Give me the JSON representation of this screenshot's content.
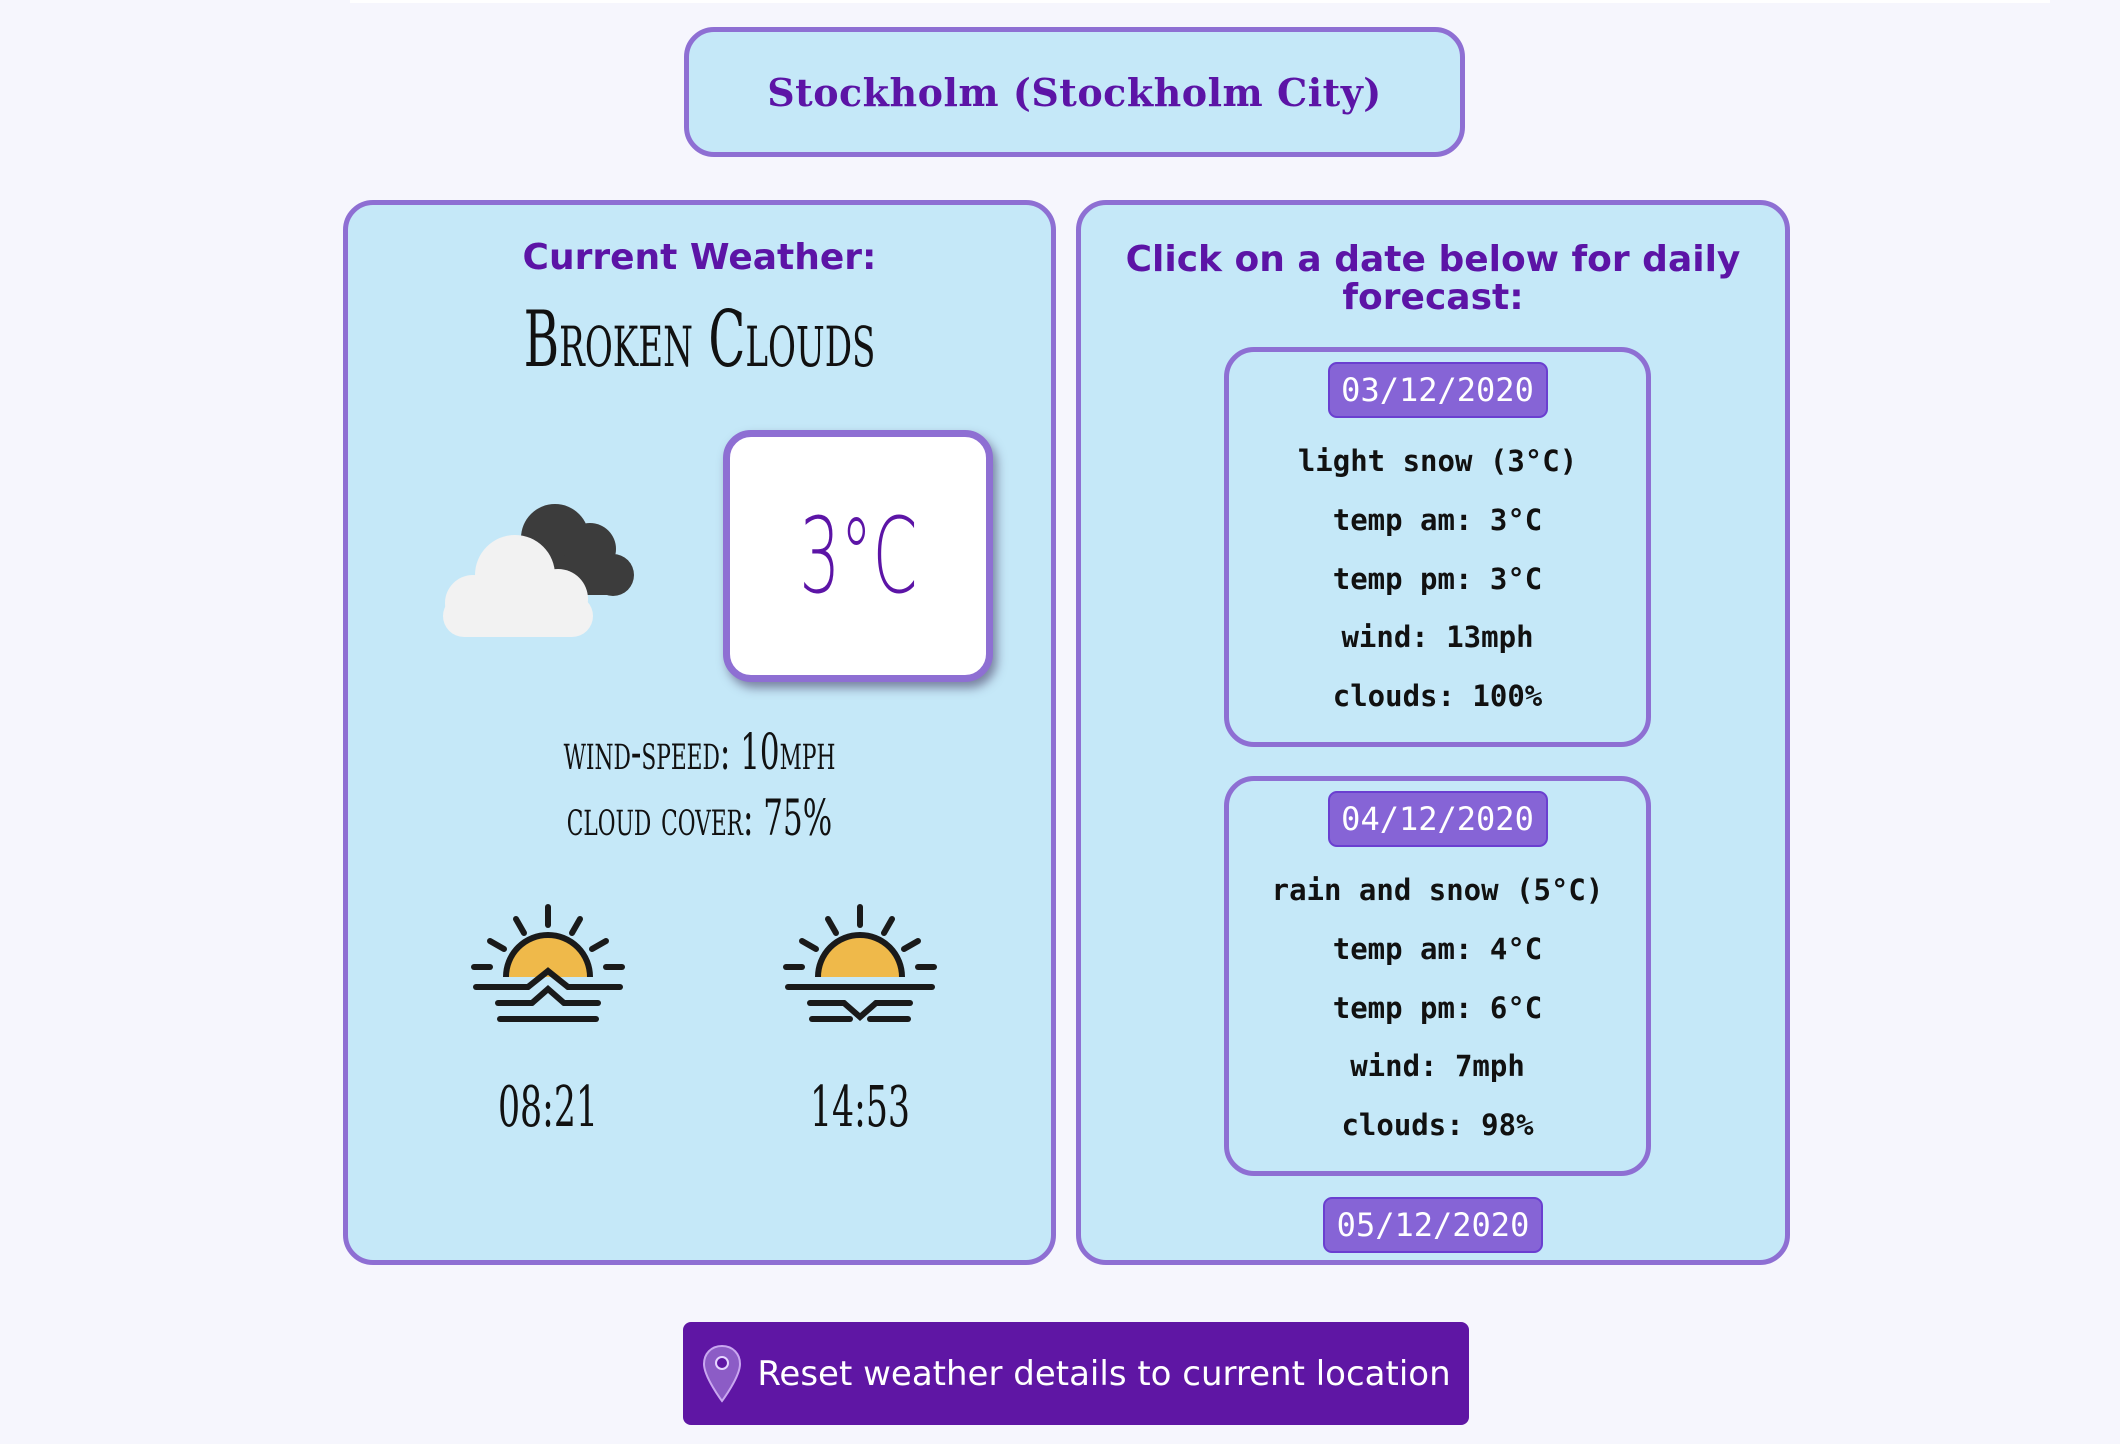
{
  "location": {
    "title": "Stockholm (Stockholm City)"
  },
  "current": {
    "heading": "Current Weather:",
    "description": "Broken Clouds",
    "icon": "broken-clouds-icon",
    "temperature": "3°C",
    "wind_speed": "wind-speed: 10mph",
    "cloud_cover": "cloud cover: 75%",
    "sunrise": {
      "icon": "sunrise-icon",
      "time": "08:21"
    },
    "sunset": {
      "icon": "sunset-icon",
      "time": "14:53"
    }
  },
  "forecast": {
    "heading": "Click on a date below for daily forecast:",
    "days": [
      {
        "date": "03/12/2020",
        "summary": "light snow (3°C)",
        "temp_am": "temp am: 3°C",
        "temp_pm": "temp pm: 3°C",
        "wind": "wind: 13mph",
        "clouds": "clouds: 100%"
      },
      {
        "date": "04/12/2020",
        "summary": "rain and snow (5°C)",
        "temp_am": "temp am: 4°C",
        "temp_pm": "temp pm: 6°C",
        "wind": "wind: 7mph",
        "clouds": "clouds: 98%"
      },
      {
        "date": "05/12/2020"
      }
    ]
  },
  "reset": {
    "label": "Reset weather details to current location",
    "icon": "map-pin-icon"
  },
  "colors": {
    "background": "#f6f6fd",
    "panel": "#c5e8f8",
    "border": "#8e6fd3",
    "accent": "#5c14a6",
    "date_tab": "#8664d6",
    "button": "#5f16a4",
    "sun": "#efb94a"
  }
}
